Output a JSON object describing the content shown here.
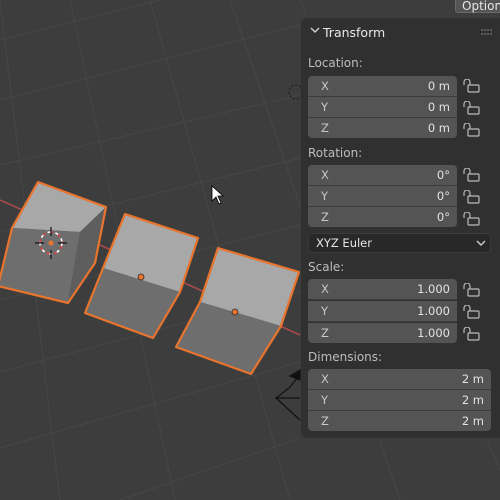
{
  "header_tab": {
    "label": "Option"
  },
  "panel": {
    "title": "Transform",
    "location": {
      "label": "Location:",
      "rows": [
        {
          "axis": "X",
          "value": "0 m"
        },
        {
          "axis": "Y",
          "value": "0 m"
        },
        {
          "axis": "Z",
          "value": "0 m"
        }
      ]
    },
    "rotation": {
      "label": "Rotation:",
      "rows": [
        {
          "axis": "X",
          "value": "0°"
        },
        {
          "axis": "Y",
          "value": "0°"
        },
        {
          "axis": "Z",
          "value": "0°"
        }
      ],
      "mode": "XYZ Euler"
    },
    "scale": {
      "label": "Scale:",
      "rows": [
        {
          "axis": "X",
          "value": "1.000"
        },
        {
          "axis": "Y",
          "value": "1.000"
        },
        {
          "axis": "Z",
          "value": "1.000"
        }
      ]
    },
    "dimensions": {
      "label": "Dimensions:",
      "rows": [
        {
          "axis": "X",
          "value": "2 m"
        },
        {
          "axis": "Y",
          "value": "2 m"
        },
        {
          "axis": "Z",
          "value": "2 m"
        }
      ]
    }
  },
  "colors": {
    "viewport_bg": "#3d3d3d",
    "panel_bg": "#303030",
    "field_bg": "#545454",
    "selection_outline": "#e8742e",
    "x_axis_line": "#a84a4a"
  },
  "icons": {
    "collapse": "chevron-down-icon",
    "lock": "unlocked-padlock-icon",
    "dropdown": "chevron-down-icon"
  }
}
